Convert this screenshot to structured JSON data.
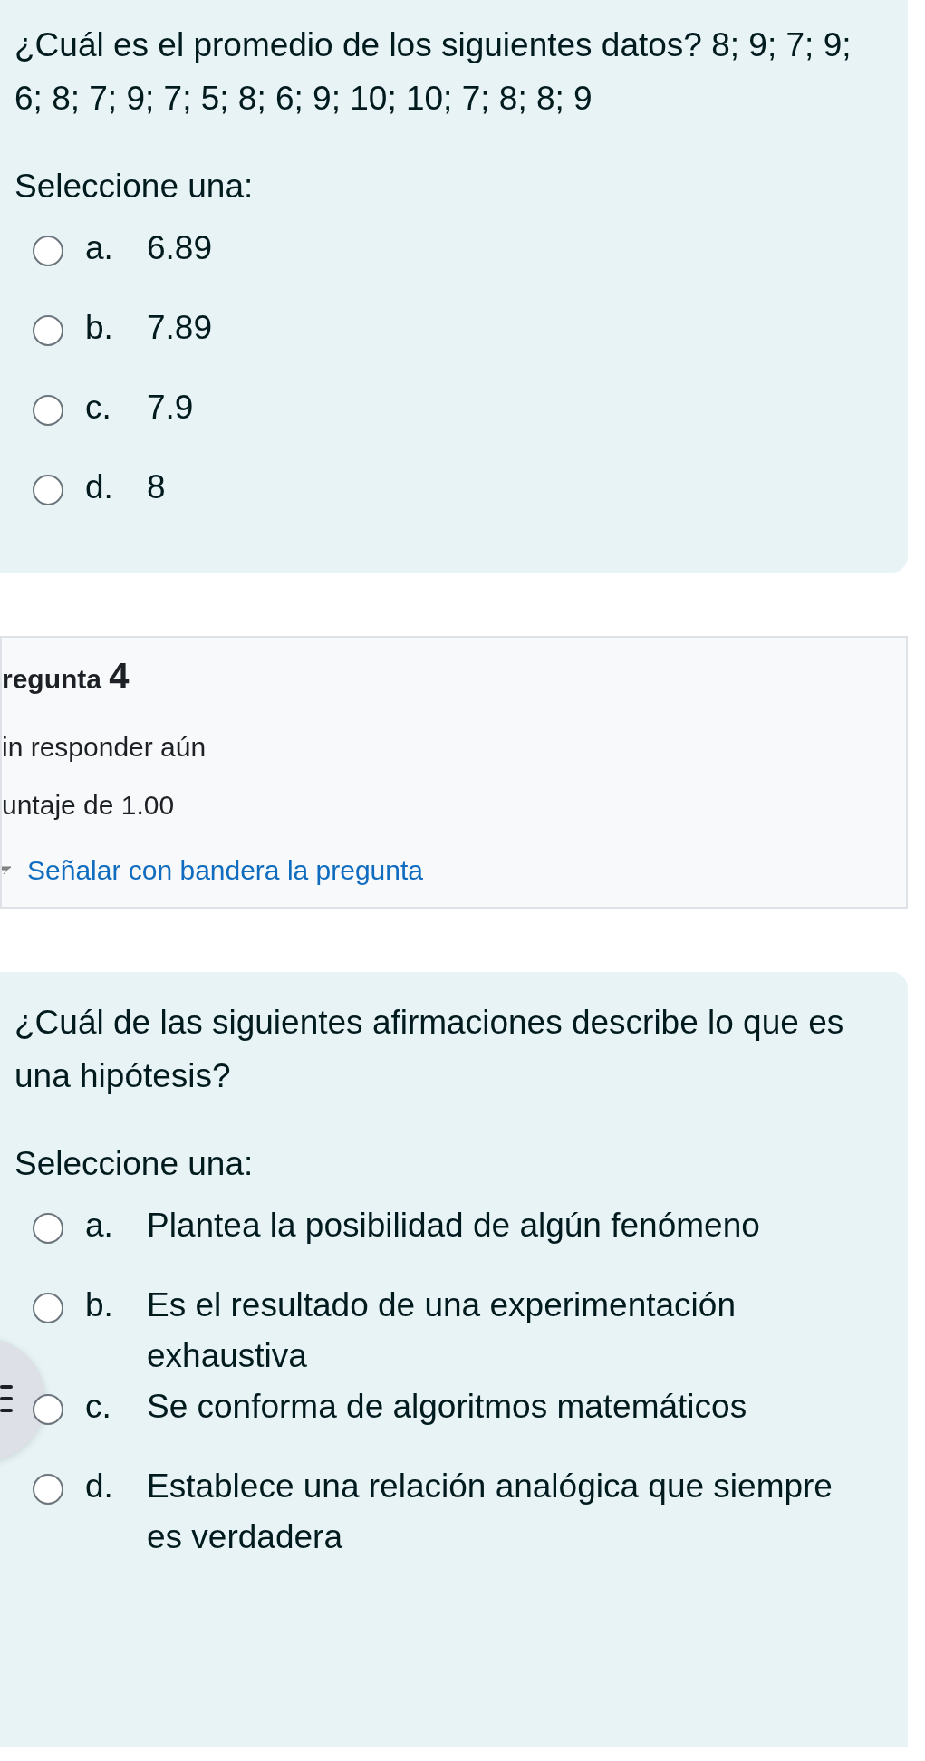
{
  "blocks": [
    {
      "kind": "content",
      "question": "¿Cuál es el promedio de los siguientes datos? 8; 9; 7; 9; 6; 8; 7; 9; 7; 5; 8; 6; 9; 10; 10; 7; 8; 8; 9",
      "prompt": "Seleccione una:",
      "options": [
        {
          "letter": "a.",
          "text": "6.89",
          "selected": false
        },
        {
          "letter": "b.",
          "text": "7.89",
          "selected": false
        },
        {
          "letter": "c.",
          "text": "7.9",
          "selected": false
        },
        {
          "letter": "d.",
          "text": "8",
          "selected": false
        }
      ]
    },
    {
      "kind": "info",
      "title": "regunta",
      "number": "4",
      "status": "in responder aún",
      "grade": "untaje de 1.00",
      "flag_link": "Señalar con bandera la pregunta"
    },
    {
      "kind": "content",
      "question": "¿Cuál de las siguientes afirmaciones describe lo que es una hipótesis?",
      "prompt": "Seleccione una:",
      "options": [
        {
          "letter": "a.",
          "text": "Plantea la posibilidad de algún fenómeno",
          "selected": false
        },
        {
          "letter": "b.",
          "text": "Es el resultado de una experimentación exhaustiva",
          "selected": false
        },
        {
          "letter": "c.",
          "text": "Se conforma de algoritmos matemáticos",
          "selected": false
        },
        {
          "letter": "d.",
          "text": "Establece una relación analógica que siempre es verdadera",
          "selected": false
        }
      ]
    }
  ]
}
